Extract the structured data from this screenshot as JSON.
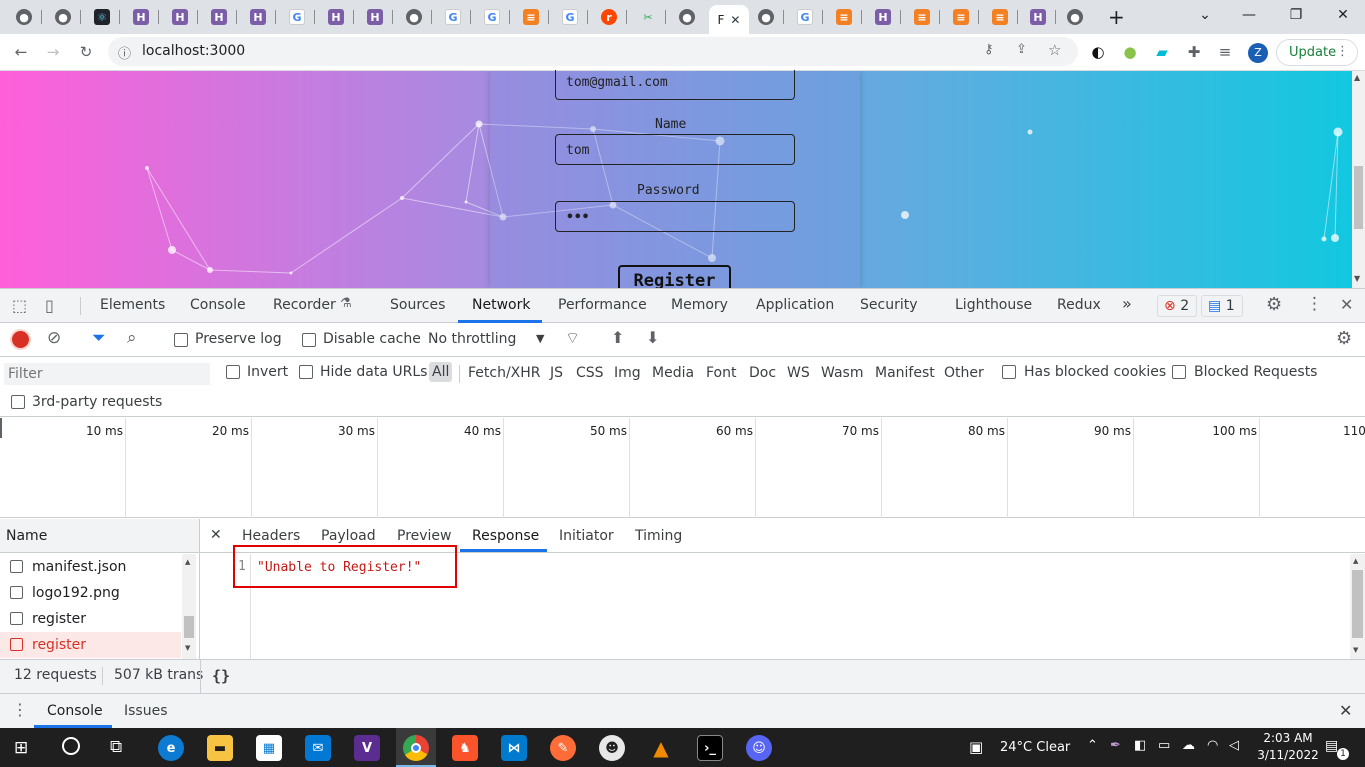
{
  "browser": {
    "url": "localhost:3000",
    "active_tab_label": "F",
    "update_label": "Update",
    "profile_initial": "Z"
  },
  "page": {
    "email_value": "tom@gmail.com",
    "name_label": "Name",
    "name_value": "tom",
    "password_label": "Password",
    "password_value": "•••",
    "register_label": "Register"
  },
  "devtools": {
    "tabs": [
      "Elements",
      "Console",
      "Recorder",
      "Sources",
      "Network",
      "Performance",
      "Memory",
      "Application",
      "Security",
      "Lighthouse",
      "Redux"
    ],
    "selected_tab": "Network",
    "more_tabs": "»",
    "error_count": "2",
    "message_count": "1",
    "toolbar": {
      "preserve_log": "Preserve log",
      "disable_cache": "Disable cache",
      "throttling": "No throttling"
    },
    "filter": {
      "placeholder": "Filter",
      "invert": "Invert",
      "hide_data_urls": "Hide data URLs",
      "types": [
        "All",
        "Fetch/XHR",
        "JS",
        "CSS",
        "Img",
        "Media",
        "Font",
        "Doc",
        "WS",
        "Wasm",
        "Manifest",
        "Other"
      ],
      "has_blocked_cookies": "Has blocked cookies",
      "blocked_requests": "Blocked Requests",
      "third_party": "3rd-party requests"
    },
    "timeline_ticks": [
      "10 ms",
      "20 ms",
      "30 ms",
      "40 ms",
      "50 ms",
      "60 ms",
      "70 ms",
      "80 ms",
      "90 ms",
      "100 ms",
      "110"
    ],
    "name_header": "Name",
    "requests": [
      {
        "name": "manifest.json",
        "error": false
      },
      {
        "name": "logo192.png",
        "error": false
      },
      {
        "name": "register",
        "error": false
      },
      {
        "name": "register",
        "error": true
      }
    ],
    "detail_tabs": [
      "Headers",
      "Payload",
      "Preview",
      "Response",
      "Initiator",
      "Timing"
    ],
    "selected_detail_tab": "Response",
    "response_line_number": "1",
    "response_text": "\"Unable to Register!\"",
    "status": {
      "requests": "12 requests",
      "transferred": "507 kB trans",
      "pretty_print": "{}"
    },
    "drawer_tabs": [
      "Console",
      "Issues"
    ]
  },
  "taskbar": {
    "weather": "24°C  Clear",
    "time": "2:03 AM",
    "date": "3/11/2022",
    "notifications": "1"
  },
  "colors": {
    "accent": "#1a73e8",
    "error": "#d93025",
    "error_row_bg": "#fce8e6",
    "response_string": "#c41a16",
    "highlight_box": "#e00000"
  }
}
